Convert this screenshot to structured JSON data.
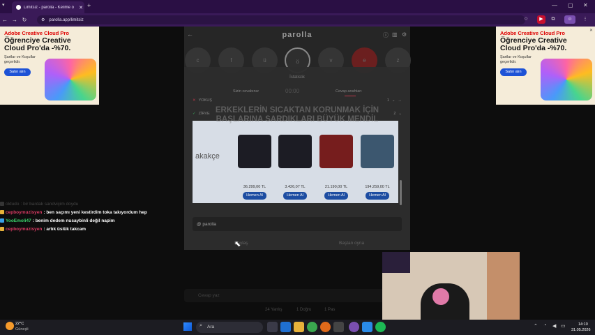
{
  "browser": {
    "tab_title": "Limitsiz - parolla - Kelime o",
    "url": "parolla.app/limitsiz"
  },
  "ads": {
    "brand": "Adobe Creative Cloud Pro",
    "headline": "Öğrenciye Creative Cloud Pro'da -%70.",
    "sub": "Şartlar ve Koşullar geçerlidir.",
    "button": "Satın alın"
  },
  "game": {
    "title": "parolla",
    "letters": [
      "c",
      "f",
      "ü",
      "ö",
      "v",
      "e",
      "z"
    ],
    "stats_label": "İstatistik",
    "headers": {
      "left": "Sizin cevabınız",
      "right": "Cevap anahtarı",
      "timer": "00:00"
    },
    "rows": [
      {
        "label": "YOKUŞ",
        "count": "1"
      },
      {
        "label": "ZİRVE",
        "count": "2"
      }
    ],
    "ghost_question": "ERKEKLERİN SICAKTAN KORUNMAK İÇİN BAŞLARINA SARDIKLARI BÜYÜK MENDİL",
    "product_ad": {
      "logo": "akakçe",
      "items": [
        {
          "price": "36.299,00 TL",
          "button": "Hemen Al"
        },
        {
          "price": "3.426,07 TL",
          "button": "Hemen Al"
        },
        {
          "price": "21.190,00 TL",
          "button": "Hemen Al"
        },
        {
          "price": "194.259,00 TL",
          "button": "Hemen Al"
        }
      ]
    },
    "player_tag": "@ parolla",
    "bottom_left": "Paylaş",
    "bottom_right": "Baştan oyna",
    "input_placeholder": "Cevap yaz",
    "counts": [
      "24 Yanlış",
      "1 Doğru",
      "1 Pas"
    ]
  },
  "chat": [
    {
      "user": "oldudo",
      "text": ": bir bardak sandviçim doydu",
      "color": "#666666"
    },
    {
      "user": "cepboymuzisyen",
      "text": ": ben saçımı yeni kestirdim toka takıyordum hep",
      "color": "#d93a63"
    },
    {
      "user": "YooEmoli47",
      "text": ": benim dedem nusaybinli değil napim",
      "color": "#3ad36b"
    },
    {
      "user": "cepboymuzisyen",
      "text": ": artık üslük takcam",
      "color": "#d93a63"
    }
  ],
  "taskbar": {
    "weather_temp": "22°C",
    "weather_desc": "Güneşli",
    "search": "Ara",
    "time": "14:10",
    "date": "31.05.2026"
  },
  "colors": {
    "accent": "#1d52d6",
    "brand_red": "#dd0000",
    "chrome": "#3a1a58"
  }
}
